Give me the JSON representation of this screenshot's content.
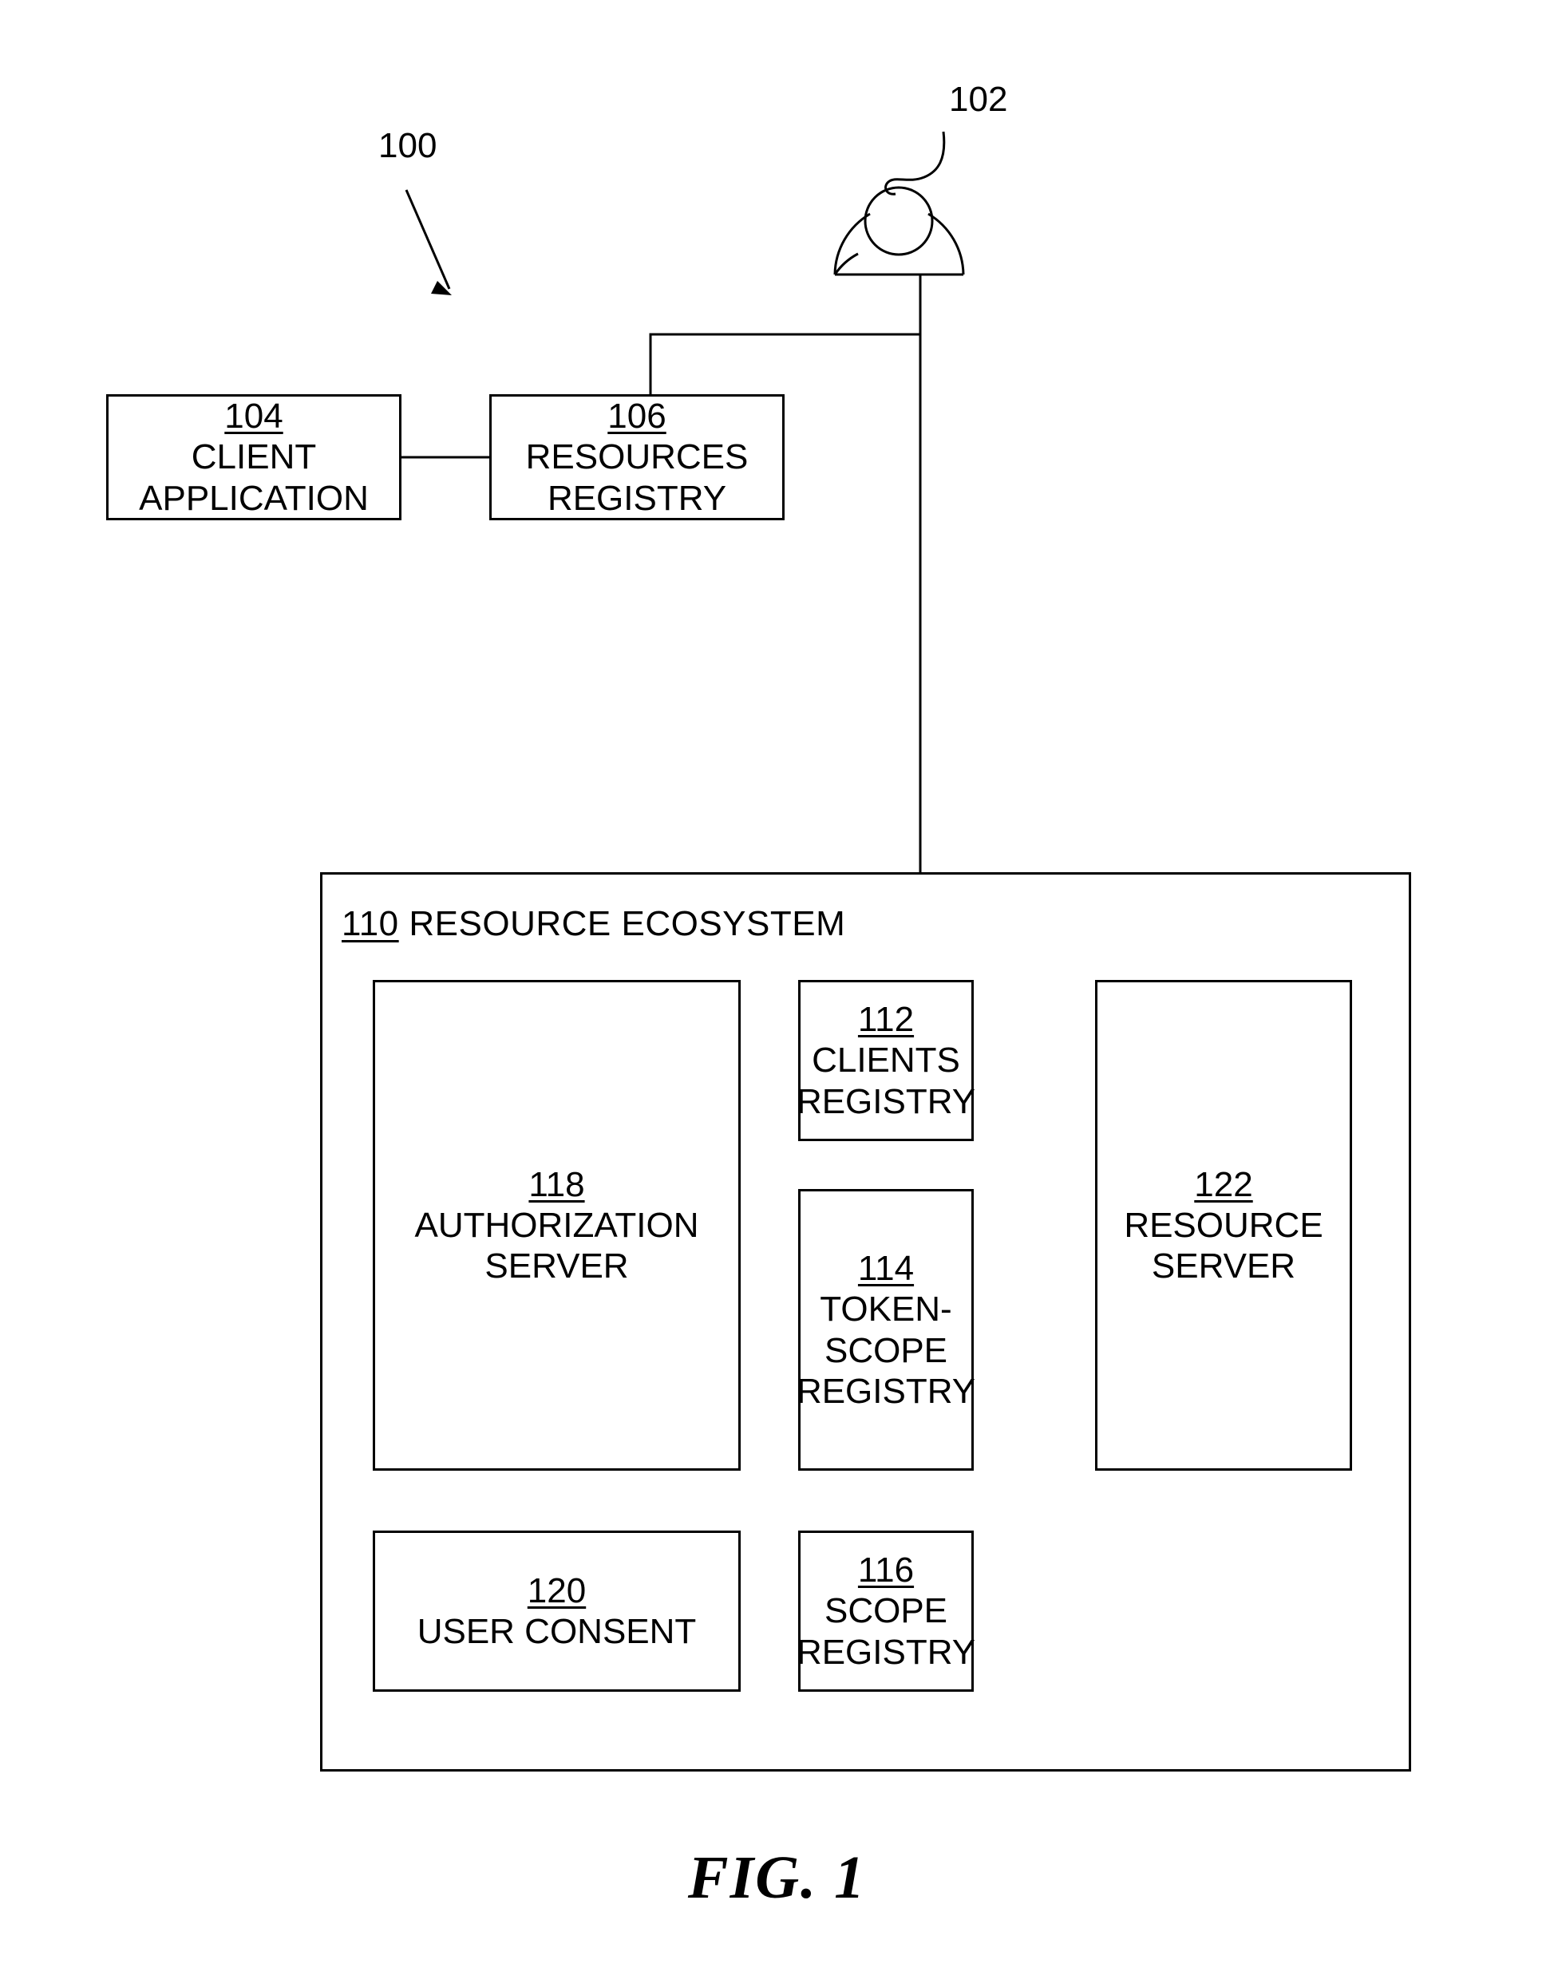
{
  "figure": {
    "caption": "FIG. 1",
    "system_callout": "100",
    "user_callout": "102"
  },
  "ecosystem": {
    "ref": "110",
    "title": "RESOURCE ECOSYSTEM"
  },
  "nodes": {
    "client_application": {
      "ref": "104",
      "label": "CLIENT\nAPPLICATION"
    },
    "resources_registry": {
      "ref": "106",
      "label": "RESOURCES\nREGISTRY"
    },
    "clients_registry": {
      "ref": "112",
      "label": "CLIENTS\nREGISTRY"
    },
    "token_scope_registry": {
      "ref": "114",
      "label": "TOKEN-\nSCOPE\nREGISTRY"
    },
    "scope_registry": {
      "ref": "116",
      "label": "SCOPE\nREGISTRY"
    },
    "authorization_server": {
      "ref": "118",
      "label": "AUTHORIZATION\nSERVER"
    },
    "user_consent": {
      "ref": "120",
      "label": "USER CONSENT"
    },
    "resource_server": {
      "ref": "122",
      "label": "RESOURCE\nSERVER"
    }
  },
  "colors": {
    "stroke": "#000000",
    "background": "#ffffff"
  }
}
